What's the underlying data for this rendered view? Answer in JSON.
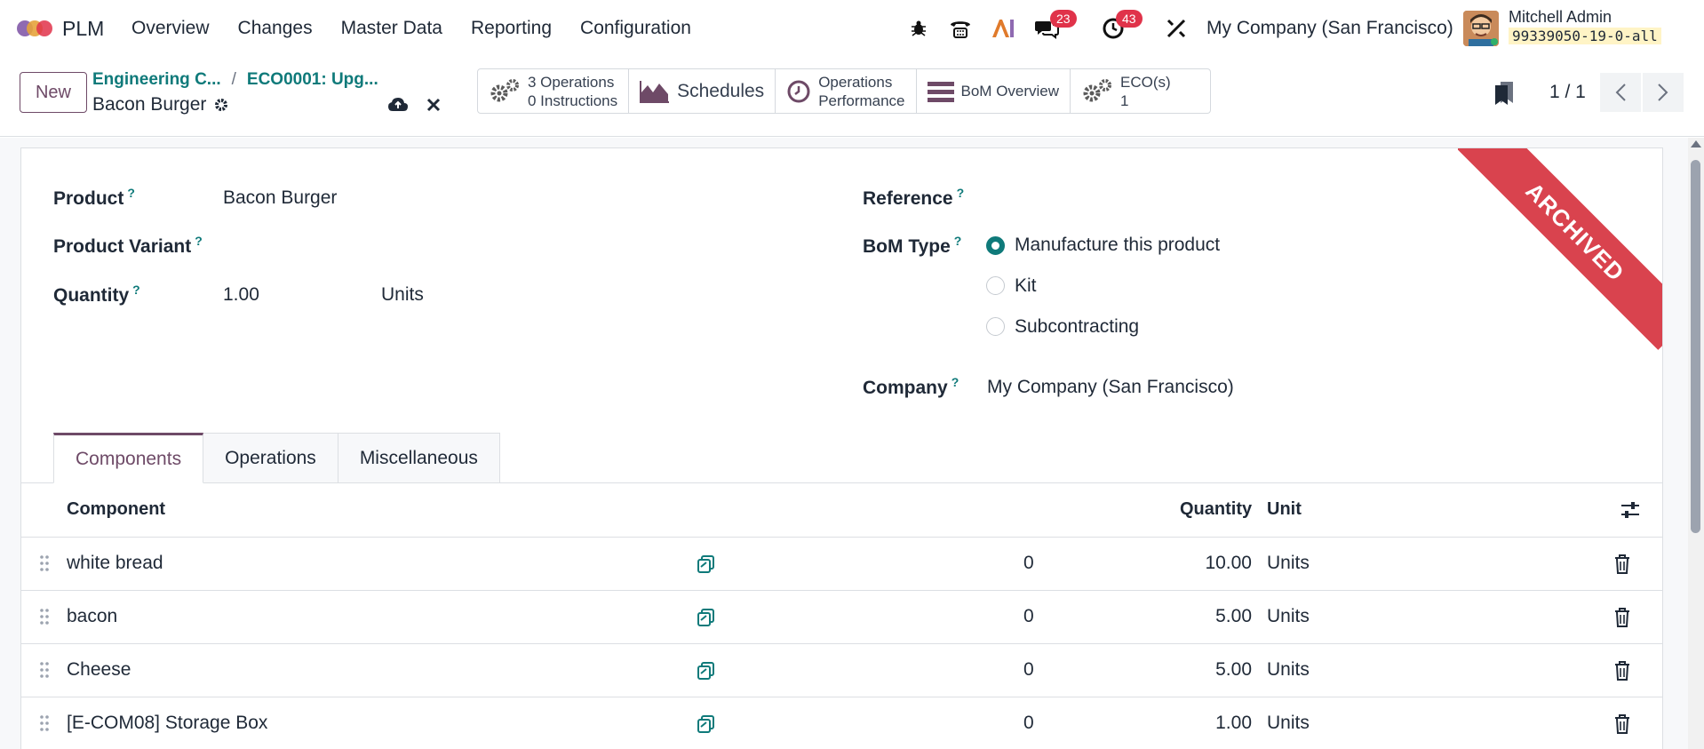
{
  "navbar": {
    "app_name": "PLM",
    "menu": [
      "Overview",
      "Changes",
      "Master Data",
      "Reporting",
      "Configuration"
    ],
    "messages_badge": "23",
    "activities_badge": "43",
    "company": "My Company (San Francisco)",
    "user_name": "Mitchell Admin",
    "database": "99339050-19-0-all"
  },
  "control_panel": {
    "new_label": "New",
    "breadcrumbs": [
      "Engineering C...",
      "ECO0001: Upg..."
    ],
    "record_title": "Bacon Burger",
    "smart_buttons": {
      "operations_line1": "3 Operations",
      "operations_line2": "0 Instructions",
      "schedules": "Schedules",
      "perf_line1": "Operations",
      "perf_line2": "Performance",
      "bom_overview": "BoM Overview",
      "eco_line1": "ECO(s)",
      "eco_line2": "1"
    },
    "pager": "1 / 1"
  },
  "form": {
    "ribbon": "ARCHIVED",
    "product_label": "Product",
    "product_value": "Bacon Burger",
    "variant_label": "Product Variant",
    "quantity_label": "Quantity",
    "quantity_value": "1.00",
    "quantity_unit": "Units",
    "reference_label": "Reference",
    "bom_type_label": "BoM Type",
    "bom_type_options": [
      "Manufacture this product",
      "Kit",
      "Subcontracting"
    ],
    "bom_type_selected": "Manufacture this product",
    "company_label": "Company",
    "company_value": "My Company (San Francisco)",
    "help_mark": "?"
  },
  "tabs": [
    "Components",
    "Operations",
    "Miscellaneous"
  ],
  "table": {
    "headers": {
      "component": "Component",
      "quantity": "Quantity",
      "unit": "Unit"
    },
    "rows": [
      {
        "component": "white bread",
        "forecast": "0",
        "quantity": "10.00",
        "unit": "Units"
      },
      {
        "component": "bacon",
        "forecast": "0",
        "quantity": "5.00",
        "unit": "Units"
      },
      {
        "component": "Cheese",
        "forecast": "0",
        "quantity": "5.00",
        "unit": "Units"
      },
      {
        "component": "[E-COM08] Storage Box",
        "forecast": "0",
        "quantity": "1.00",
        "unit": "Units"
      }
    ]
  },
  "colors": {
    "primary": "#6e4a67",
    "teal": "#0f7a7a",
    "ribbon": "#d9434e",
    "badge": "#e0334a"
  }
}
